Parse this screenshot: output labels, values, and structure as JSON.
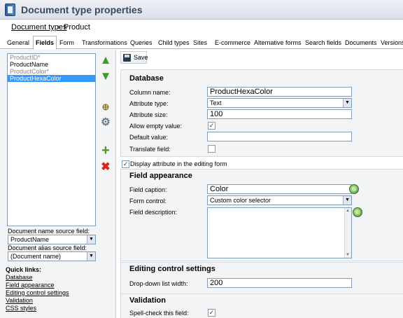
{
  "header": {
    "title": "Document type properties",
    "icon": "document-type-icon"
  },
  "breadcrumb": {
    "link": "Document types",
    "separator": "›",
    "current": "Product"
  },
  "tabs": [
    "General",
    "Fields",
    "Form",
    "Transformations",
    "Queries",
    "Child types",
    "Sites",
    "E-commerce",
    "Alternative forms",
    "Search fields",
    "Documents",
    "Versions"
  ],
  "active_tab": "Fields",
  "fields_list": [
    {
      "name": "ProductID*",
      "state": "system"
    },
    {
      "name": "ProductName",
      "state": "normal"
    },
    {
      "name": "ProductColor*",
      "state": "system"
    },
    {
      "name": "ProductHexaColor",
      "state": "selected"
    }
  ],
  "left_panel": {
    "name_source_label": "Document name source field:",
    "name_source_value": "ProductName",
    "alias_source_label": "Document alias source field:",
    "alias_source_value": "(Document name)",
    "quick_links_title": "Quick links:",
    "quick_links": [
      "Database",
      "Field appearance",
      "Editing control settings",
      "Validation",
      "CSS styles"
    ]
  },
  "toolbar": {
    "save_label": "Save"
  },
  "database": {
    "title": "Database",
    "column_name_label": "Column name:",
    "column_name_value": "ProductHexaColor",
    "attribute_type_label": "Attribute type:",
    "attribute_type_value": "Text",
    "attribute_size_label": "Attribute size:",
    "attribute_size_value": "100",
    "allow_empty_label": "Allow empty value:",
    "allow_empty_checked": true,
    "default_value_label": "Default value:",
    "default_value_value": "",
    "translate_label": "Translate field:",
    "translate_checked": false
  },
  "display_attribute": {
    "label": "Display attribute in the editing form",
    "checked": true
  },
  "field_appearance": {
    "title": "Field appearance",
    "caption_label": "Field caption:",
    "caption_value": "Color",
    "form_control_label": "Form control:",
    "form_control_value": "Custom color selector",
    "description_label": "Field description:",
    "description_value": ""
  },
  "editing_control": {
    "title": "Editing control settings",
    "dropdown_width_label": "Drop-down list width:",
    "dropdown_width_value": "200"
  },
  "validation": {
    "title": "Validation",
    "spellcheck_label": "Spell-check this field:",
    "spellcheck_checked": true
  },
  "colors": {
    "accent": "#3399ff",
    "header_text": "#3a4a5c",
    "panel_bg": "#f3f4f6",
    "green": "#4b9a2e",
    "red": "#d9261c"
  }
}
